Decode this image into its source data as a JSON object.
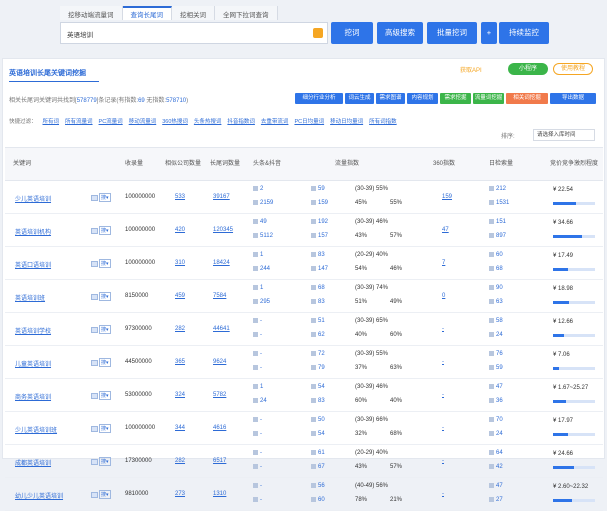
{
  "tabs": [
    "挖移动端流量词",
    "查询长尾词",
    "挖相关词",
    "全网下拉词查询"
  ],
  "active_tab": 1,
  "search": {
    "value": "英语培训"
  },
  "buttons": {
    "search": "挖词",
    "advanced": "高级搜索",
    "batch": "批量挖词",
    "monitor": "持续监控",
    "plus": "+"
  },
  "panel": {
    "title": "英语培训长尾关键词挖掘",
    "get_api": "获取API",
    "mini_program": "小程序",
    "guide": "使用教程",
    "summary_prefix": "相关长尾词关键词共找到",
    "summary_count": "578779",
    "summary_mid": "条记录(有指数:",
    "summary_idx": "69",
    "summary_mid2": " 无指数:",
    "summary_noidx": "578710",
    "summary_end": ")"
  },
  "action_buttons": [
    "细分行业分析",
    "词云生成",
    "需求图谱",
    "内容规划",
    "需求挖掘",
    "流量词挖掘",
    "相关词挖掘",
    "导出数据"
  ],
  "action_colors": [
    "#2e74e8",
    "#2e74e8",
    "#2e74e8",
    "#2e74e8",
    "#3bb549",
    "#3bb549",
    "#f17a4b",
    "#2e74e8"
  ],
  "quick_label": "快捷过滤：",
  "quick_items": [
    "所有词",
    "所有流量词",
    "PC流量词",
    "移动流量词",
    "360热搜词",
    "头条热搜词",
    "抖音指数词",
    "去重带流词",
    "PC日均量词",
    "移动日均量词",
    "所有词指数"
  ],
  "sort_label": "排序:",
  "sort_value": "请选择入库时间",
  "columns": [
    "关键词",
    "收录量",
    "相似公司数量",
    "长尾词数量",
    "头条&抖音",
    "流量指数",
    "360指数",
    "日检索量",
    "竞价竞争激烈程度"
  ],
  "rows": [
    {
      "kw": "少儿英语培训",
      "inc": "100000000",
      "cmp": "533",
      "long": "39167",
      "tt": "2",
      "dy": "2159",
      "ix1": "59",
      "ix2": "159",
      "r1": "(30-39) 55%",
      "r2": "45%",
      "r3": "55%",
      "s360": "159",
      "d1": "212",
      "d2": "1531",
      "price": "¥ 22.54",
      "bar": 0.55
    },
    {
      "kw": "英语培训机构",
      "inc": "100000000",
      "cmp": "420",
      "long": "120345",
      "tt": "49",
      "dy": "5112",
      "ix1": "192",
      "ix2": "157",
      "r1": "(30-39) 46%",
      "r2": "43%",
      "r3": "57%",
      "s360": "47",
      "d1": "151",
      "d2": "897",
      "price": "¥ 34.66",
      "bar": 0.7
    },
    {
      "kw": "英语口语培训",
      "inc": "100000000",
      "cmp": "310",
      "long": "18424",
      "tt": "1",
      "dy": "244",
      "ix1": "83",
      "ix2": "147",
      "r1": "(20-29) 40%",
      "r2": "54%",
      "r3": "46%",
      "s360": "7",
      "d1": "60",
      "d2": "68",
      "price": "¥ 17.49",
      "bar": 0.35
    },
    {
      "kw": "英语培训班",
      "inc": "8150000",
      "cmp": "459",
      "long": "7584",
      "tt": "1",
      "dy": "295",
      "ix1": "68",
      "ix2": "83",
      "r1": "(30-39) 74%",
      "r2": "51%",
      "r3": "49%",
      "s360": "0",
      "d1": "90",
      "d2": "63",
      "price": "¥ 18.98",
      "bar": 0.38
    },
    {
      "kw": "英语培训学校",
      "inc": "97300000",
      "cmp": "282",
      "long": "44641",
      "tt": "-",
      "dy": "-",
      "ix1": "51",
      "ix2": "62",
      "r1": "(30-39) 65%",
      "r2": "40%",
      "r3": "60%",
      "s360": "-",
      "d1": "58",
      "d2": "24",
      "price": "¥ 12.66",
      "bar": 0.25
    },
    {
      "kw": "儿童英语培训",
      "inc": "44500000",
      "cmp": "365",
      "long": "9624",
      "tt": "-",
      "dy": "-",
      "ix1": "72",
      "ix2": "79",
      "r1": "(30-39) 55%",
      "r2": "37%",
      "r3": "63%",
      "s360": "-",
      "d1": "76",
      "d2": "59",
      "price": "¥ 7.06",
      "bar": 0.15
    },
    {
      "kw": "商务英语培训",
      "inc": "53000000",
      "cmp": "324",
      "long": "5782",
      "tt": "1",
      "dy": "24",
      "ix1": "54",
      "ix2": "83",
      "r1": "(30-39) 46%",
      "r2": "60%",
      "r3": "40%",
      "s360": "-",
      "d1": "47",
      "d2": "36",
      "price": "¥ 1.67~25.27",
      "bar": 0.3
    },
    {
      "kw": "少儿英语培训班",
      "inc": "100000000",
      "cmp": "344",
      "long": "4616",
      "tt": "-",
      "dy": "-",
      "ix1": "50",
      "ix2": "54",
      "r1": "(30-39) 66%",
      "r2": "32%",
      "r3": "68%",
      "s360": "-",
      "d1": "70",
      "d2": "24",
      "price": "¥ 17.97",
      "bar": 0.36
    },
    {
      "kw": "成都英语培训",
      "inc": "17300000",
      "cmp": "282",
      "long": "6517",
      "tt": "-",
      "dy": "-",
      "ix1": "61",
      "ix2": "67",
      "r1": "(20-29) 40%",
      "r2": "43%",
      "r3": "57%",
      "s360": "-",
      "d1": "64",
      "d2": "42",
      "price": "¥ 24.66",
      "bar": 0.5
    },
    {
      "kw": "幼儿少儿英语培训",
      "inc": "9810000",
      "cmp": "273",
      "long": "1310",
      "tt": "-",
      "dy": "-",
      "ix1": "56",
      "ix2": "60",
      "r1": "(40-49) 56%",
      "r2": "78%",
      "r3": "21%",
      "s360": "-",
      "d1": "47",
      "d2": "27",
      "price": "¥ 2.60~22.32",
      "bar": 0.45
    }
  ]
}
